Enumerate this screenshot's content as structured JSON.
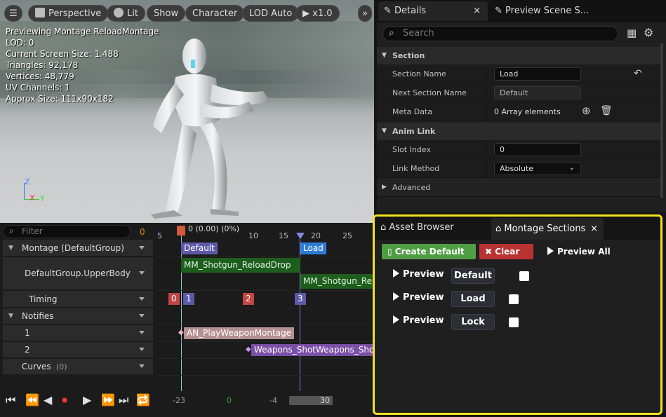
{
  "viewport": {
    "toolbar": {
      "perspective": "Perspective",
      "lit": "Lit",
      "show": "Show",
      "character": "Character",
      "lod": "LOD Auto",
      "speed": "x1.0"
    },
    "stats": [
      "Previewing Montage ReloadMontage",
      "LOD: 0",
      "Current Screen Size: 1.488",
      "Triangles: 92,178",
      "Vertices: 48,779",
      "UV Channels: 1",
      "Approx Size: 111x90x182"
    ],
    "axes": {
      "z": "Z",
      "x": "X",
      "y": "Y"
    }
  },
  "details": {
    "tabs": {
      "details": "Details",
      "preview": "Preview Scene S..."
    },
    "search_placeholder": "Search",
    "section_cat": "Section",
    "section_name_label": "Section Name",
    "section_name": "Load",
    "next_section_label": "Next Section Name",
    "next_section": "Default",
    "meta_label": "Meta Data",
    "meta_value": "0 Array elements",
    "anim_link_cat": "Anim Link",
    "slot_index_label": "Slot Index",
    "slot_index": "0",
    "link_method_label": "Link Method",
    "link_method": "Absolute",
    "advanced_cat": "Advanced"
  },
  "timeline": {
    "filter_placeholder": "Filter",
    "filter_count": "0",
    "ruler": {
      "t5": "5",
      "t0": "0 (0.00) (0%)",
      "t10": "10",
      "t15": "15",
      "t20": "20",
      "t25": "25"
    },
    "tracks": {
      "montage": "Montage (DefaultGroup)",
      "slot": "DefaultGroup.UpperBody",
      "timing": "Timing",
      "notifies": "Notifies",
      "n1": "1",
      "n2": "2",
      "curves": "Curves",
      "curves_count": "(0)"
    },
    "sections": {
      "default": "Default",
      "load": "Load"
    },
    "clips": {
      "clip1": "MM_Shotgun_ReloadDrop",
      "clip2": "MM_Shotgun_Relo"
    },
    "timing": {
      "t0": "0",
      "t1": "1",
      "t2": "2",
      "t3": "3"
    },
    "notifies": {
      "n1": "AN_PlayWeaponMontage",
      "n2": "Weapons_ShotWeapons_Shot"
    },
    "bottom": {
      "start": "-23",
      "zero": "0",
      "minus4": "-4",
      "end": "30"
    }
  },
  "montage_sections": {
    "tabs": {
      "asset_browser": "Asset Browser",
      "montage_sections": "Montage Sections"
    },
    "create_default": "Create Default",
    "clear": "Clear",
    "preview_all": "Preview All",
    "preview_label": "Preview",
    "sections": [
      "Default",
      "Load",
      "Lock"
    ],
    "colors": {
      "highlight": "#f2e21f",
      "create": "#4f9e43",
      "clear": "#b83232"
    }
  }
}
